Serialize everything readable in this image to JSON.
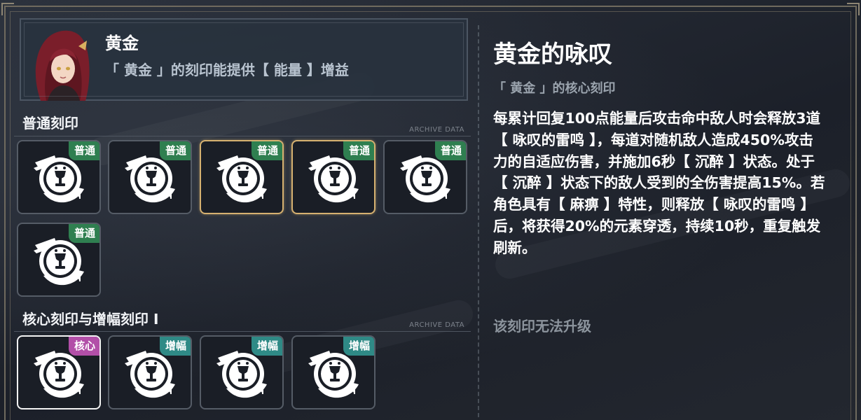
{
  "header": {
    "title": "黄金",
    "subtitle": "「 黄金 」的刻印能提供【 能量 】增益"
  },
  "sections": {
    "normal": {
      "title": "普通刻印",
      "tag": "ARCHIVE DATA"
    },
    "core": {
      "title": "核心刻印与增幅刻印 I",
      "tag": "ARCHIVE DATA"
    }
  },
  "normal_tiles": [
    {
      "badge": "普通",
      "state": "default"
    },
    {
      "badge": "普通",
      "state": "default"
    },
    {
      "badge": "普通",
      "state": "selected-gold"
    },
    {
      "badge": "普通",
      "state": "selected-gold"
    },
    {
      "badge": "普通",
      "state": "default"
    },
    {
      "badge": "普通",
      "state": "default"
    }
  ],
  "core_tiles": [
    {
      "badge": "核心",
      "state": "selected-white"
    },
    {
      "badge": "增幅",
      "state": "default"
    },
    {
      "badge": "增幅",
      "state": "default"
    },
    {
      "badge": "增幅",
      "state": "default"
    }
  ],
  "detail": {
    "title": "黄金的咏叹",
    "subtitle": "「 黄金 」的核心刻印",
    "description": "每累计回复100点能量后攻击命中敌人时会释放3道【 咏叹的雷鸣 】，每道对随机敌人造成450%攻击力的自适应伤害，并施加6秒【 沉醉 】状态。处于【 沉醉 】状态下的敌人受到的全伤害提高15%。若角色具有【 麻痹 】特性，则释放【 咏叹的雷鸣 】后，将获得20%的元素穿透，持续10秒，重复触发刷新。",
    "upgrade_note": "该刻印无法升级"
  },
  "colors": {
    "badge_normal": "#2f7f50",
    "badge_amplify": "#2f8a86",
    "badge_core": "#b24fa8",
    "selected_gold": "#d6b170"
  },
  "icons": {
    "emblem": "lion-chalice-emblem-icon",
    "portrait": "character-portrait"
  }
}
